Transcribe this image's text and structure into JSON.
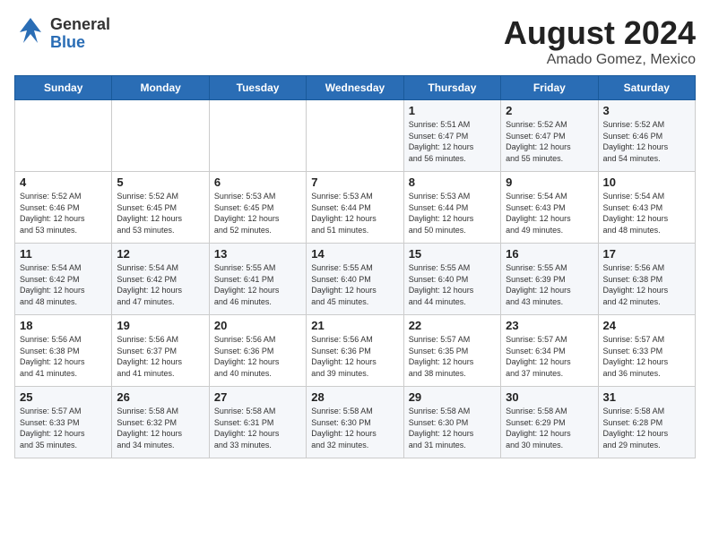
{
  "logo": {
    "general": "General",
    "blue": "Blue"
  },
  "title": {
    "month_year": "August 2024",
    "location": "Amado Gomez, Mexico"
  },
  "weekdays": [
    "Sunday",
    "Monday",
    "Tuesday",
    "Wednesday",
    "Thursday",
    "Friday",
    "Saturday"
  ],
  "weeks": [
    [
      {
        "day": "",
        "detail": ""
      },
      {
        "day": "",
        "detail": ""
      },
      {
        "day": "",
        "detail": ""
      },
      {
        "day": "",
        "detail": ""
      },
      {
        "day": "1",
        "detail": "Sunrise: 5:51 AM\nSunset: 6:47 PM\nDaylight: 12 hours\nand 56 minutes."
      },
      {
        "day": "2",
        "detail": "Sunrise: 5:52 AM\nSunset: 6:47 PM\nDaylight: 12 hours\nand 55 minutes."
      },
      {
        "day": "3",
        "detail": "Sunrise: 5:52 AM\nSunset: 6:46 PM\nDaylight: 12 hours\nand 54 minutes."
      }
    ],
    [
      {
        "day": "4",
        "detail": "Sunrise: 5:52 AM\nSunset: 6:46 PM\nDaylight: 12 hours\nand 53 minutes."
      },
      {
        "day": "5",
        "detail": "Sunrise: 5:52 AM\nSunset: 6:45 PM\nDaylight: 12 hours\nand 53 minutes."
      },
      {
        "day": "6",
        "detail": "Sunrise: 5:53 AM\nSunset: 6:45 PM\nDaylight: 12 hours\nand 52 minutes."
      },
      {
        "day": "7",
        "detail": "Sunrise: 5:53 AM\nSunset: 6:44 PM\nDaylight: 12 hours\nand 51 minutes."
      },
      {
        "day": "8",
        "detail": "Sunrise: 5:53 AM\nSunset: 6:44 PM\nDaylight: 12 hours\nand 50 minutes."
      },
      {
        "day": "9",
        "detail": "Sunrise: 5:54 AM\nSunset: 6:43 PM\nDaylight: 12 hours\nand 49 minutes."
      },
      {
        "day": "10",
        "detail": "Sunrise: 5:54 AM\nSunset: 6:43 PM\nDaylight: 12 hours\nand 48 minutes."
      }
    ],
    [
      {
        "day": "11",
        "detail": "Sunrise: 5:54 AM\nSunset: 6:42 PM\nDaylight: 12 hours\nand 48 minutes."
      },
      {
        "day": "12",
        "detail": "Sunrise: 5:54 AM\nSunset: 6:42 PM\nDaylight: 12 hours\nand 47 minutes."
      },
      {
        "day": "13",
        "detail": "Sunrise: 5:55 AM\nSunset: 6:41 PM\nDaylight: 12 hours\nand 46 minutes."
      },
      {
        "day": "14",
        "detail": "Sunrise: 5:55 AM\nSunset: 6:40 PM\nDaylight: 12 hours\nand 45 minutes."
      },
      {
        "day": "15",
        "detail": "Sunrise: 5:55 AM\nSunset: 6:40 PM\nDaylight: 12 hours\nand 44 minutes."
      },
      {
        "day": "16",
        "detail": "Sunrise: 5:55 AM\nSunset: 6:39 PM\nDaylight: 12 hours\nand 43 minutes."
      },
      {
        "day": "17",
        "detail": "Sunrise: 5:56 AM\nSunset: 6:38 PM\nDaylight: 12 hours\nand 42 minutes."
      }
    ],
    [
      {
        "day": "18",
        "detail": "Sunrise: 5:56 AM\nSunset: 6:38 PM\nDaylight: 12 hours\nand 41 minutes."
      },
      {
        "day": "19",
        "detail": "Sunrise: 5:56 AM\nSunset: 6:37 PM\nDaylight: 12 hours\nand 41 minutes."
      },
      {
        "day": "20",
        "detail": "Sunrise: 5:56 AM\nSunset: 6:36 PM\nDaylight: 12 hours\nand 40 minutes."
      },
      {
        "day": "21",
        "detail": "Sunrise: 5:56 AM\nSunset: 6:36 PM\nDaylight: 12 hours\nand 39 minutes."
      },
      {
        "day": "22",
        "detail": "Sunrise: 5:57 AM\nSunset: 6:35 PM\nDaylight: 12 hours\nand 38 minutes."
      },
      {
        "day": "23",
        "detail": "Sunrise: 5:57 AM\nSunset: 6:34 PM\nDaylight: 12 hours\nand 37 minutes."
      },
      {
        "day": "24",
        "detail": "Sunrise: 5:57 AM\nSunset: 6:33 PM\nDaylight: 12 hours\nand 36 minutes."
      }
    ],
    [
      {
        "day": "25",
        "detail": "Sunrise: 5:57 AM\nSunset: 6:33 PM\nDaylight: 12 hours\nand 35 minutes."
      },
      {
        "day": "26",
        "detail": "Sunrise: 5:58 AM\nSunset: 6:32 PM\nDaylight: 12 hours\nand 34 minutes."
      },
      {
        "day": "27",
        "detail": "Sunrise: 5:58 AM\nSunset: 6:31 PM\nDaylight: 12 hours\nand 33 minutes."
      },
      {
        "day": "28",
        "detail": "Sunrise: 5:58 AM\nSunset: 6:30 PM\nDaylight: 12 hours\nand 32 minutes."
      },
      {
        "day": "29",
        "detail": "Sunrise: 5:58 AM\nSunset: 6:30 PM\nDaylight: 12 hours\nand 31 minutes."
      },
      {
        "day": "30",
        "detail": "Sunrise: 5:58 AM\nSunset: 6:29 PM\nDaylight: 12 hours\nand 30 minutes."
      },
      {
        "day": "31",
        "detail": "Sunrise: 5:58 AM\nSunset: 6:28 PM\nDaylight: 12 hours\nand 29 minutes."
      }
    ]
  ]
}
